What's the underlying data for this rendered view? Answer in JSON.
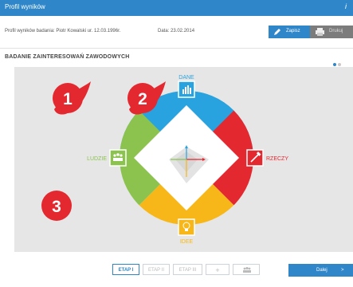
{
  "window": {
    "title": "Profil wyników",
    "help_icon": "info-icon"
  },
  "info": {
    "profile_text": "Profil wyników badania: Piotr Kowalski ur. 12.03.1996r.",
    "date_text": "Data: 23.02.2014"
  },
  "toolbar": {
    "save_label": "Zapisz",
    "print_label": "Drukuj"
  },
  "section": {
    "title": "BADANIE ZAINTERESOWAŃ ZAWODOWYCH"
  },
  "badges": {
    "one": "1",
    "two": "2",
    "three": "3"
  },
  "wheel": {
    "top_label": "DANE",
    "right_label": "RZECZY",
    "bottom_label": "IDEE",
    "left_label": "LUDZIE",
    "colors": {
      "top": "#29a3df",
      "right": "#e4282f",
      "bottom": "#f7b718",
      "left": "#8cc34f"
    }
  },
  "tabs": {
    "etap1": "ETAP I",
    "etap2": "ETAP II",
    "etap3": "ETAP III",
    "plus": "+",
    "people_icon": "people-icon"
  },
  "next_button": {
    "label": "Dalej",
    "arrow": ">"
  }
}
